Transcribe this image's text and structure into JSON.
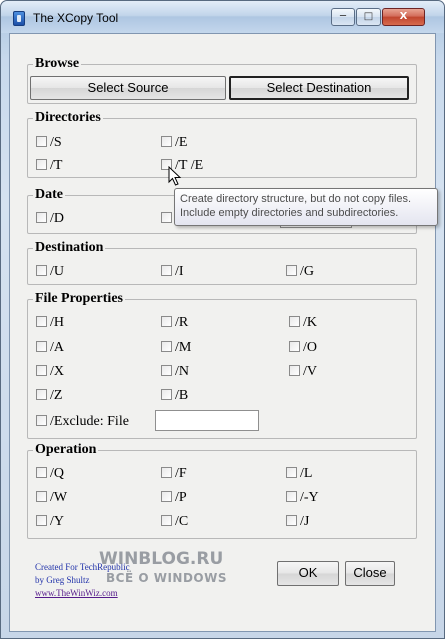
{
  "window": {
    "title": "The XCopy Tool",
    "controls": {
      "minimize": "─",
      "maximize": "□",
      "close": "X"
    }
  },
  "browse": {
    "title": "Browse",
    "select_source": "Select Source",
    "select_destination": "Select Destination"
  },
  "directories": {
    "title": "Directories",
    "options": [
      "/S",
      "/E",
      "/T",
      "/T /E"
    ]
  },
  "date": {
    "title": "Date",
    "options": [
      "/D"
    ]
  },
  "tooltip": {
    "line1": "Create directory structure, but do not copy files.",
    "line2": "Include empty directories and subdirectories."
  },
  "destination": {
    "title": "Destination",
    "options": [
      "/U",
      "/I",
      "/G"
    ]
  },
  "file_properties": {
    "title": "File Properties",
    "options": [
      "/H",
      "/R",
      "/K",
      "/A",
      "/M",
      "/O",
      "/X",
      "/N",
      "/V",
      "/Z",
      "/B"
    ],
    "exclude_label": "/Exclude: File",
    "exclude_value": ""
  },
  "operation": {
    "title": "Operation",
    "options": [
      "/Q",
      "/F",
      "/L",
      "/W",
      "/P",
      "/-Y",
      "/Y",
      "/C",
      "/J"
    ]
  },
  "footer": {
    "credit1": "Created For TechRepublic",
    "credit2": "by Greg Shultz",
    "link": "www.TheWinWiz.com",
    "ok": "OK",
    "close": "Close"
  },
  "watermark": {
    "line1": "WINBLOG.RU",
    "line2": "ВСЁ О WINDOWS"
  },
  "colors": {
    "title_gradient": "#c2d5ea",
    "close_button": "#c0452e",
    "client_bg": "#f1f1ef",
    "credit_text": "#2233aa"
  }
}
